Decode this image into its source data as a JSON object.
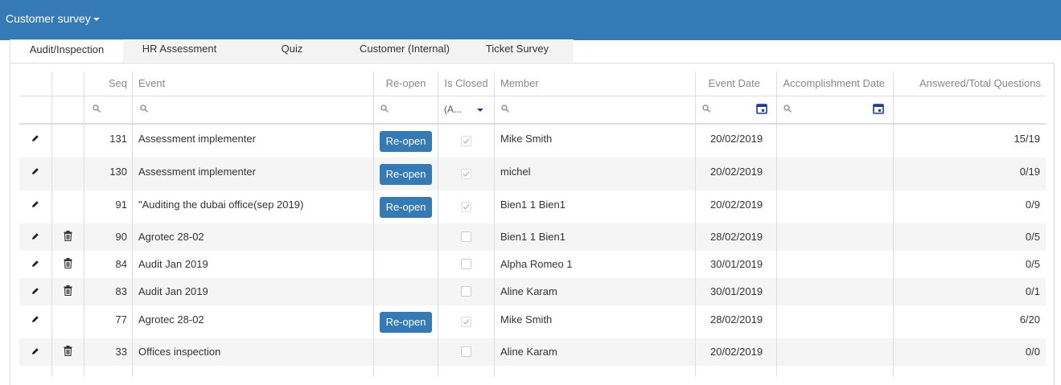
{
  "app": {
    "title": "Customer survey"
  },
  "tabs": [
    {
      "label": "Audit/Inspection",
      "active": true
    },
    {
      "label": "HR Assessment",
      "active": false
    },
    {
      "label": "Quiz",
      "active": false
    },
    {
      "label": "Customer (Internal)",
      "active": false
    },
    {
      "label": "Ticket Survey",
      "active": false
    }
  ],
  "table": {
    "headers": {
      "seq": "Seq",
      "event": "Event",
      "reopen": "Re-open",
      "is_closed": "Is Closed",
      "member": "Member",
      "event_date": "Event Date",
      "accomplishment_date": "Accomplishment Date",
      "answered": "Answered/Total Questions"
    },
    "filters": {
      "is_closed_value": "(A..."
    },
    "reopen_label": "Re-open",
    "rows": [
      {
        "seq": "131",
        "event": "Assessment implementer",
        "member": "Mike Smith",
        "event_date": "20/02/2019",
        "accomplishment_date": "",
        "answered": "15/19",
        "reopen": true,
        "closed": true,
        "deletable": false
      },
      {
        "seq": "130",
        "event": "Assessment implementer",
        "member": "michel",
        "event_date": "20/02/2019",
        "accomplishment_date": "",
        "answered": "0/19",
        "reopen": true,
        "closed": true,
        "deletable": false
      },
      {
        "seq": "91",
        "event": "\"Auditing the dubai office(sep 2019)",
        "member": "Bien1 1 Bien1",
        "event_date": "20/02/2019",
        "accomplishment_date": "",
        "answered": "0/9",
        "reopen": true,
        "closed": true,
        "deletable": false
      },
      {
        "seq": "90",
        "event": "Agrotec 28-02",
        "member": "Bien1 1 Bien1",
        "event_date": "28/02/2019",
        "accomplishment_date": "",
        "answered": "0/5",
        "reopen": false,
        "closed": false,
        "deletable": true
      },
      {
        "seq": "84",
        "event": "Audit Jan 2019",
        "member": "Alpha Romeo 1",
        "event_date": "30/01/2019",
        "accomplishment_date": "",
        "answered": "0/5",
        "reopen": false,
        "closed": false,
        "deletable": true
      },
      {
        "seq": "83",
        "event": "Audit Jan 2019",
        "member": "Aline Karam",
        "event_date": "30/01/2019",
        "accomplishment_date": "",
        "answered": "0/1",
        "reopen": false,
        "closed": false,
        "deletable": true
      },
      {
        "seq": "77",
        "event": "Agrotec 28-02",
        "member": "Mike Smith",
        "event_date": "28/02/2019",
        "accomplishment_date": "",
        "answered": "6/20",
        "reopen": true,
        "closed": true,
        "deletable": false
      },
      {
        "seq": "33",
        "event": "Offices inspection",
        "member": "Aline Karam",
        "event_date": "20/02/2019",
        "accomplishment_date": "",
        "answered": "0/0",
        "reopen": false,
        "closed": false,
        "deletable": true
      }
    ]
  },
  "colors": {
    "brand": "#337ab7",
    "calendar": "#1a3a9e"
  }
}
